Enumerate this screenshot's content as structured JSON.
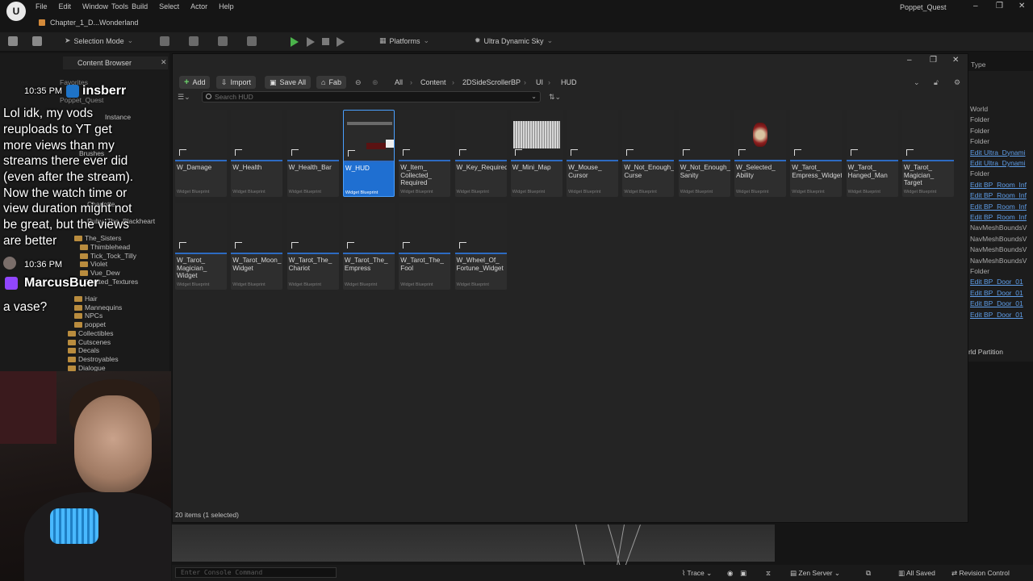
{
  "menu": {
    "items": [
      "File",
      "Edit",
      "Window",
      "Tools",
      "Build",
      "Select",
      "Actor",
      "Help"
    ],
    "project": "Poppet_Quest",
    "level_tab": "Chapter_1_D...Wonderland"
  },
  "toolbar": {
    "mode": "Selection Mode",
    "platforms": "Platforms",
    "sky": "Ultra Dynamic Sky"
  },
  "content_browser": {
    "tab": "Content Browser",
    "buttons": {
      "add": "Add",
      "import": "Import",
      "save_all": "Save All",
      "fab": "Fab"
    },
    "breadcrumb": [
      "All",
      "Content",
      "2DSideScrollerBP",
      "UI",
      "HUD"
    ],
    "search_placeholder": "Search HUD",
    "status": "20 items (1 selected)",
    "assets": [
      {
        "name": "W_Damage",
        "kind": "Widget Blueprint"
      },
      {
        "name": "W_Health",
        "kind": "Widget Blueprint"
      },
      {
        "name": "W_Health_Bar",
        "kind": "Widget Blueprint"
      },
      {
        "name": "W_HUD",
        "kind": "Widget Blueprint",
        "selected": true
      },
      {
        "name": "W_Item_\nCollected_\nRequired",
        "kind": "Widget Blueprint"
      },
      {
        "name": "W_Key_Required",
        "kind": "Widget Blueprint"
      },
      {
        "name": "W_Mini_Map",
        "kind": "Widget Blueprint"
      },
      {
        "name": "W_Mouse_\nCursor",
        "kind": "Widget Blueprint"
      },
      {
        "name": "W_Not_Enough_\nCurse",
        "kind": "Widget Blueprint"
      },
      {
        "name": "W_Not_Enough_\nSanity",
        "kind": "Widget Blueprint"
      },
      {
        "name": "W_Selected_\nAbility",
        "kind": "Widget Blueprint"
      },
      {
        "name": "W_Tarot_\nEmpress_Widget",
        "kind": "Widget Blueprint"
      },
      {
        "name": "W_Tarot_\nHanged_Man",
        "kind": "Widget Blueprint"
      },
      {
        "name": "W_Tarot_\nMagician_\nTarget",
        "kind": "Widget Blueprint"
      },
      {
        "name": "W_Tarot_\nMagician_\nWidget",
        "kind": "Widget Blueprint"
      },
      {
        "name": "W_Tarot_Moon_\nWidget",
        "kind": "Widget Blueprint"
      },
      {
        "name": "W_Tarot_The_\nChariot",
        "kind": "Widget Blueprint"
      },
      {
        "name": "W_Tarot_The_\nEmpress",
        "kind": "Widget Blueprint"
      },
      {
        "name": "W_Tarot_The_\nFool",
        "kind": "Widget Blueprint"
      },
      {
        "name": "W_Wheel_Of_\nFortune_Widget",
        "kind": "Widget Blueprint"
      }
    ]
  },
  "tree": {
    "items": [
      "Instance",
      "Brushes",
      "Charlotte",
      "Ruby_The_Blackheart",
      "The_Sisters",
      "Thimblehead",
      "Tick_Tock_Tilly",
      "Violet",
      "Vue_Dew",
      "Created_Textures",
      "Hair",
      "Mannequins",
      "NPCs",
      "poppet",
      "Collectibles",
      "Cutscenes",
      "Decals",
      "Destroyables",
      "Dialogue"
    ],
    "favorites": "Favorites",
    "root": "Poppet_Quest"
  },
  "chat": {
    "time1": "10:35 PM",
    "user1": "insberr",
    "message1": [
      "Lol idk, my vods",
      "reuploads to YT get",
      "more views than my",
      "streams there ever did",
      "(even after the stream).",
      "Now the watch time or",
      "view duration might not",
      "be great, but the views",
      "are better"
    ],
    "time2": "10:36 PM",
    "user2": "MarcusBuer",
    "message2": "a vase?"
  },
  "outliner": {
    "header": "Type",
    "rows": [
      {
        "text": "World",
        "link": false
      },
      {
        "text": "Folder",
        "link": false
      },
      {
        "text": "Folder",
        "link": false
      },
      {
        "text": "Folder",
        "link": false
      },
      {
        "text": "Edit Ultra_Dynami",
        "link": true
      },
      {
        "text": "Edit Ultra_Dynami",
        "link": true
      },
      {
        "text": "Folder",
        "link": false
      },
      {
        "text": "Edit BP_Room_Inf",
        "link": true
      },
      {
        "text": "Edit BP_Room_Inf",
        "link": true
      },
      {
        "text": "Edit BP_Room_Inf",
        "link": true
      },
      {
        "text": "Edit BP_Room_Inf",
        "link": true
      },
      {
        "text": "NavMeshBoundsV",
        "link": false
      },
      {
        "text": "NavMeshBoundsV",
        "link": false
      },
      {
        "text": "NavMeshBoundsV",
        "link": false
      },
      {
        "text": "NavMeshBoundsV",
        "link": false
      },
      {
        "text": "Folder",
        "link": false
      },
      {
        "text": "Edit BP_Door_01",
        "link": true
      },
      {
        "text": "Edit BP_Door_01",
        "link": true
      },
      {
        "text": "Edit BP_Door_01",
        "link": true
      },
      {
        "text": "Edit BP_Door_01",
        "link": true
      }
    ],
    "world_partition": "rld Partition"
  },
  "bottombar": {
    "console_placeholder": "Enter Console Command",
    "trace": "Trace",
    "zen_server": "Zen Server",
    "all_saved": "All Saved",
    "revision_control": "Revision Control"
  },
  "colors": {
    "accent": "#1f6fd1",
    "play": "#4bb34b",
    "link": "#5f9ee9",
    "folder": "#b98c3e"
  }
}
